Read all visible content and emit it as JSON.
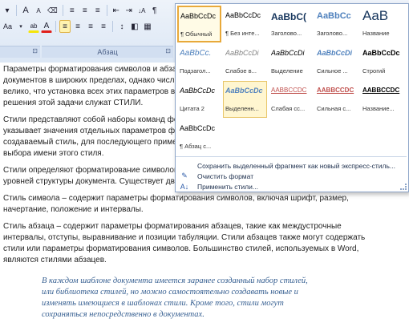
{
  "ribbon": {
    "row1": [
      "A",
      "A",
      "Aa",
      "≡",
      "≡",
      "≡",
      "⇤",
      "⇥",
      "↓A",
      "¶"
    ],
    "row2": [
      "Aa",
      "ab",
      "A",
      "≡",
      "≡",
      "≡",
      "≡",
      "↕",
      "◧",
      "▦"
    ],
    "paragraph_group_label": "Абзац"
  },
  "gallery": {
    "tiles": [
      {
        "preview": "AaBbCcDc",
        "label": "¶ Обычный",
        "state": "selected"
      },
      {
        "preview": "AaBbCcDc",
        "label": "¶ Без инте...",
        "state": "normal"
      },
      {
        "preview": "AaBbC(",
        "label": "Заголово...",
        "state": "normal"
      },
      {
        "preview": "AaBbCc",
        "label": "Заголово...",
        "state": "normal"
      },
      {
        "preview": "AaB",
        "label": "Название",
        "state": "normal"
      },
      {
        "preview": "AaBbCc.",
        "label": "Подзагол...",
        "state": "normal"
      },
      {
        "preview": "AaBbCcDi",
        "label": "Слабое в...",
        "state": "normal"
      },
      {
        "preview": "AaBbCcDi",
        "label": "Выделение",
        "state": "normal"
      },
      {
        "preview": "AaBbCcDi",
        "label": "Сильное ...",
        "state": "normal"
      },
      {
        "preview": "AaBbCcDc",
        "label": "Строгий",
        "state": "normal"
      },
      {
        "preview": "AaBbCcDc",
        "label": "Цитата 2",
        "state": "normal"
      },
      {
        "preview": "AaBbCcDc",
        "label": "Выделенн...",
        "state": "hover"
      },
      {
        "preview": "AABBCCDC",
        "label": "Слабая сс...",
        "state": "normal"
      },
      {
        "preview": "AABBCCDC",
        "label": "Сильная с...",
        "state": "normal"
      },
      {
        "preview": "AABBCCDC",
        "label": "Название...",
        "state": "normal"
      },
      {
        "preview": "AaBbCcDc",
        "label": "¶ Абзац с...",
        "state": "normal"
      }
    ],
    "commands": [
      {
        "icon": "save-selection-icon",
        "glyph": "",
        "label": "Сохранить выделенный фрагмент как новый экспресс-стиль..."
      },
      {
        "icon": "clear-format-icon",
        "glyph": "✎",
        "label": "Очистить формат"
      },
      {
        "icon": "apply-styles-icon",
        "glyph": "A↓",
        "label": "Применить стили..."
      }
    ]
  },
  "document": {
    "paragraphs": [
      "Параметры форматирования символов и абзацев Wo",
      "документов в широких пределах, однако число возм",
      "велико, что установка всех этих параметров вручну",
      "решения этой задачи служат СТИЛИ.",
      "Стили представляют собой наборы команд формати",
      "указывает значения отдельных параметров формата",
      "создаваемый стиль, для последующего применения",
      "выбора имени этого стиля.",
      "Стили определяют форматирование символов, текс",
      "уровней структуры документа. Существует два различных типа стилей:",
      "Стиль символа – содержит параметры форматирования символов, включая шрифт, размер,",
      "начертание, положение и интервалы.",
      "Стиль абзаца – содержит параметры форматирования абзацев, такие как междустрочные",
      "интервалы, отступы, выравнивание и позиции табуляции. Стили абзацев также могут содержать",
      "стили или параметры форматирования символов. Большинство стилей, используемых в Word,",
      "являются стилями абзацев."
    ],
    "quote": [
      "В каждом шаблоне документа имеется заранее созданный набор стилей,",
      "или библиотека стилей, но можно самостоятельно создавать новые и",
      "изменять имеющиеся в шаблонах стили. Кроме того, стили могут",
      "сохраняться непосредственно в документах."
    ]
  }
}
